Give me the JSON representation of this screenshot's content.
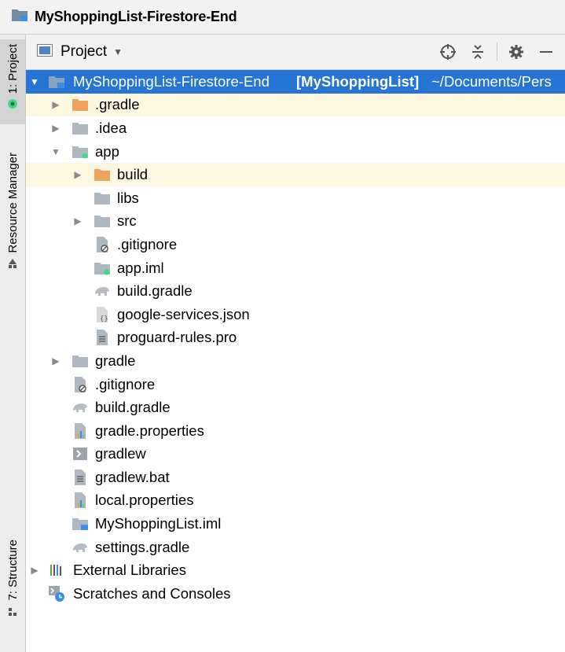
{
  "window": {
    "title": "MyShoppingList-Firestore-End"
  },
  "sidebar_tabs": {
    "project": "1: Project",
    "resource_manager": "Resource Manager",
    "structure": "7: Structure"
  },
  "toolbar": {
    "view_label": "Project"
  },
  "tree": {
    "root": {
      "name": "MyShoppingList-Firestore-End",
      "module": "[MyShoppingList]",
      "path": "~/Documents/Pers"
    },
    "items": [
      "",
      ".gradle",
      ".idea",
      "app",
      "build",
      "libs",
      "src",
      ".gitignore",
      "app.iml",
      "build.gradle",
      "google-services.json",
      "proguard-rules.pro",
      "gradle",
      ".gitignore",
      "build.gradle",
      "gradle.properties",
      "gradlew",
      "gradlew.bat",
      "local.properties",
      "MyShoppingList.iml",
      "settings.gradle",
      "External Libraries",
      "Scratches and Consoles"
    ]
  },
  "colors": {
    "selection": "#2675d5",
    "highlight_row": "#fdf8e1",
    "excluded_folder": "#f0a35e",
    "folder": "#afb8c1"
  }
}
